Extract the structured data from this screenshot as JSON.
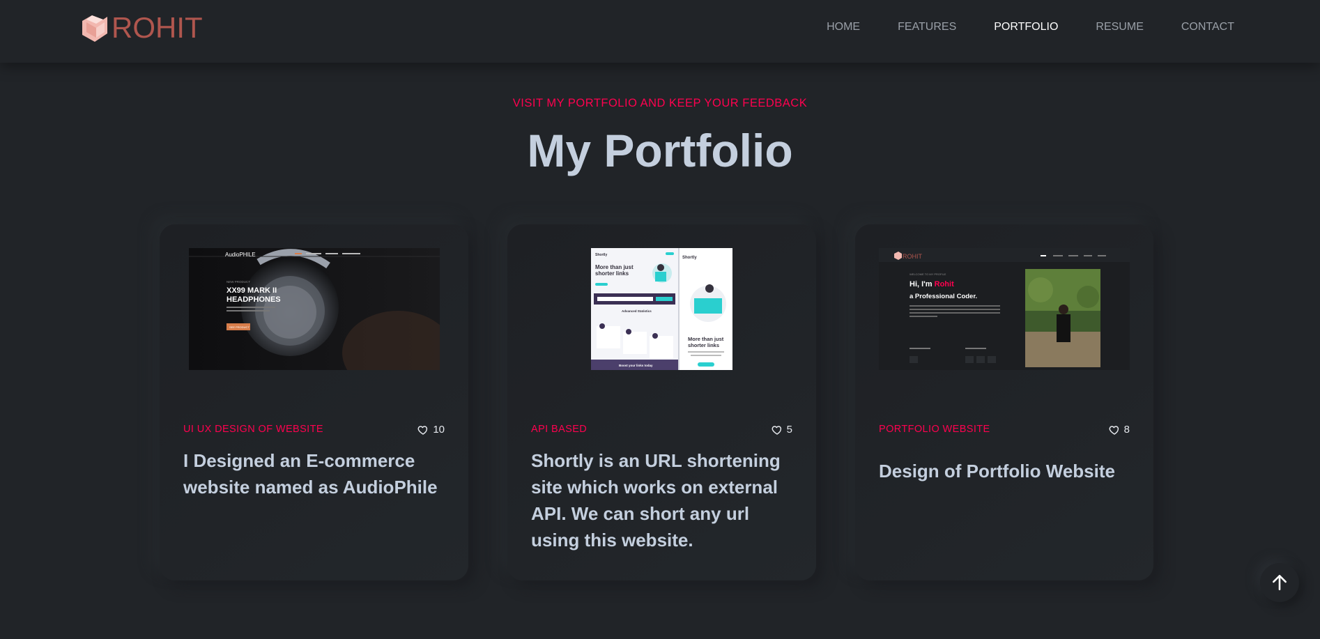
{
  "brand": {
    "name": "ROHIT",
    "logo_color": "#f2b8b0"
  },
  "nav": {
    "items": [
      {
        "label": "HOME",
        "active": false
      },
      {
        "label": "FEATURES",
        "active": false
      },
      {
        "label": "PORTFOLIO",
        "active": true
      },
      {
        "label": "RESUME",
        "active": false
      },
      {
        "label": "CONTACT",
        "active": false
      }
    ]
  },
  "section": {
    "subtitle": "VISIT MY PORTFOLIO AND KEEP YOUR FEEDBACK",
    "title": "My Portfolio"
  },
  "cards": [
    {
      "category": "UI UX DESIGN OF WEBSITE",
      "likes": "10",
      "title": "I Designed an E-commerce website named as AudioPhile",
      "thumb": {
        "brand": "AudioPHILE",
        "eyebrow": "NEW PRODUCT",
        "headline_1": "XX99 MARK II",
        "headline_2": "HEADPHONES",
        "cta": "SEE PRODUCT"
      }
    },
    {
      "category": "API BASED",
      "likes": "5",
      "title": "Shortly is an URL shortening site which works on external API. We can short any url using this website.",
      "thumb": {
        "brand": "Shortly",
        "headline_1": "More than just",
        "headline_2": "shorter links",
        "stats": "Advanced Statistics",
        "footer": "Boost your links today"
      }
    },
    {
      "category": "PORTFOLIO WEBSITE",
      "likes": "8",
      "title": "Design of Portfolio Website",
      "thumb": {
        "brand": "ROHIT",
        "welcome": "WELCOME TO MY PROFILE",
        "hi": "Hi, I'm ",
        "name": "Rohit",
        "role": "a Professional Coder."
      }
    }
  ],
  "colors": {
    "accent": "#ff014f",
    "background": "#212428",
    "text": "#c4cfde"
  },
  "scroll_top": {
    "icon": "arrow-up-icon"
  }
}
